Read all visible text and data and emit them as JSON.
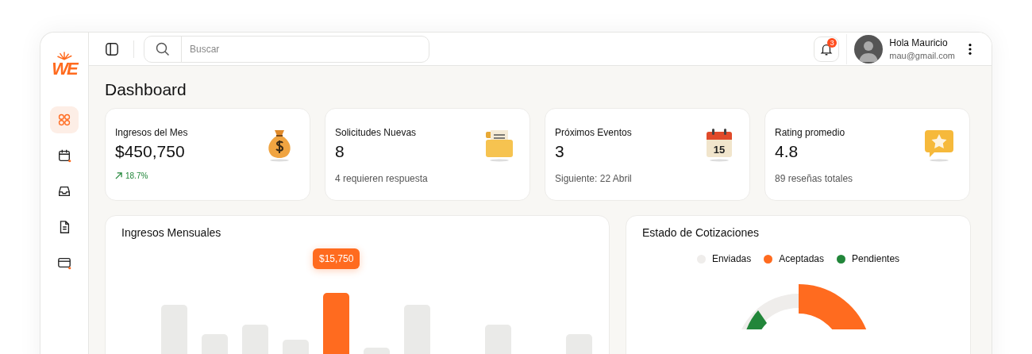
{
  "sidebar": {
    "logo": "WE",
    "items": [
      {
        "kind": "grid",
        "selected": true,
        "dot": false
      },
      {
        "kind": "calendar",
        "selected": false,
        "dot": true
      },
      {
        "kind": "inbox",
        "selected": false,
        "dot": false
      },
      {
        "kind": "document",
        "selected": false,
        "dot": false
      },
      {
        "kind": "card",
        "selected": false,
        "dot": true
      }
    ]
  },
  "topbar": {
    "search": {
      "placeholder": "Buscar"
    },
    "notifications": {
      "badge": "3"
    },
    "user": {
      "greeting": "Hola Mauricio",
      "email": "mau@gmail.com"
    }
  },
  "page_title": "Dashboard",
  "stats": [
    {
      "kind": "trend",
      "label": "Ingresos del Mes",
      "value": "$450,750",
      "detail": "18.7%"
    },
    {
      "kind": "note",
      "label": "Solicitudes Nuevas",
      "value": "8",
      "detail": "4 requieren respuesta"
    },
    {
      "kind": "note",
      "label": "Próximos Eventos",
      "value": "3",
      "detail": "Siguiente: 22 Abril",
      "icon_text": "15"
    },
    {
      "kind": "note",
      "label": "Rating promedio",
      "value": "4.8",
      "detail": "89 reseñas totales"
    }
  ],
  "monthly_income": {
    "title": "Ingresos Mensuales",
    "tooltip": "$15,750"
  },
  "quote_status": {
    "title": "Estado de Cotizaciones",
    "legend": [
      {
        "label": "Enviadas",
        "color": "#efedeb"
      },
      {
        "label": "Aceptadas",
        "color": "#ff6b1f"
      },
      {
        "label": "Pendientes",
        "color": "#22863a"
      }
    ]
  }
}
